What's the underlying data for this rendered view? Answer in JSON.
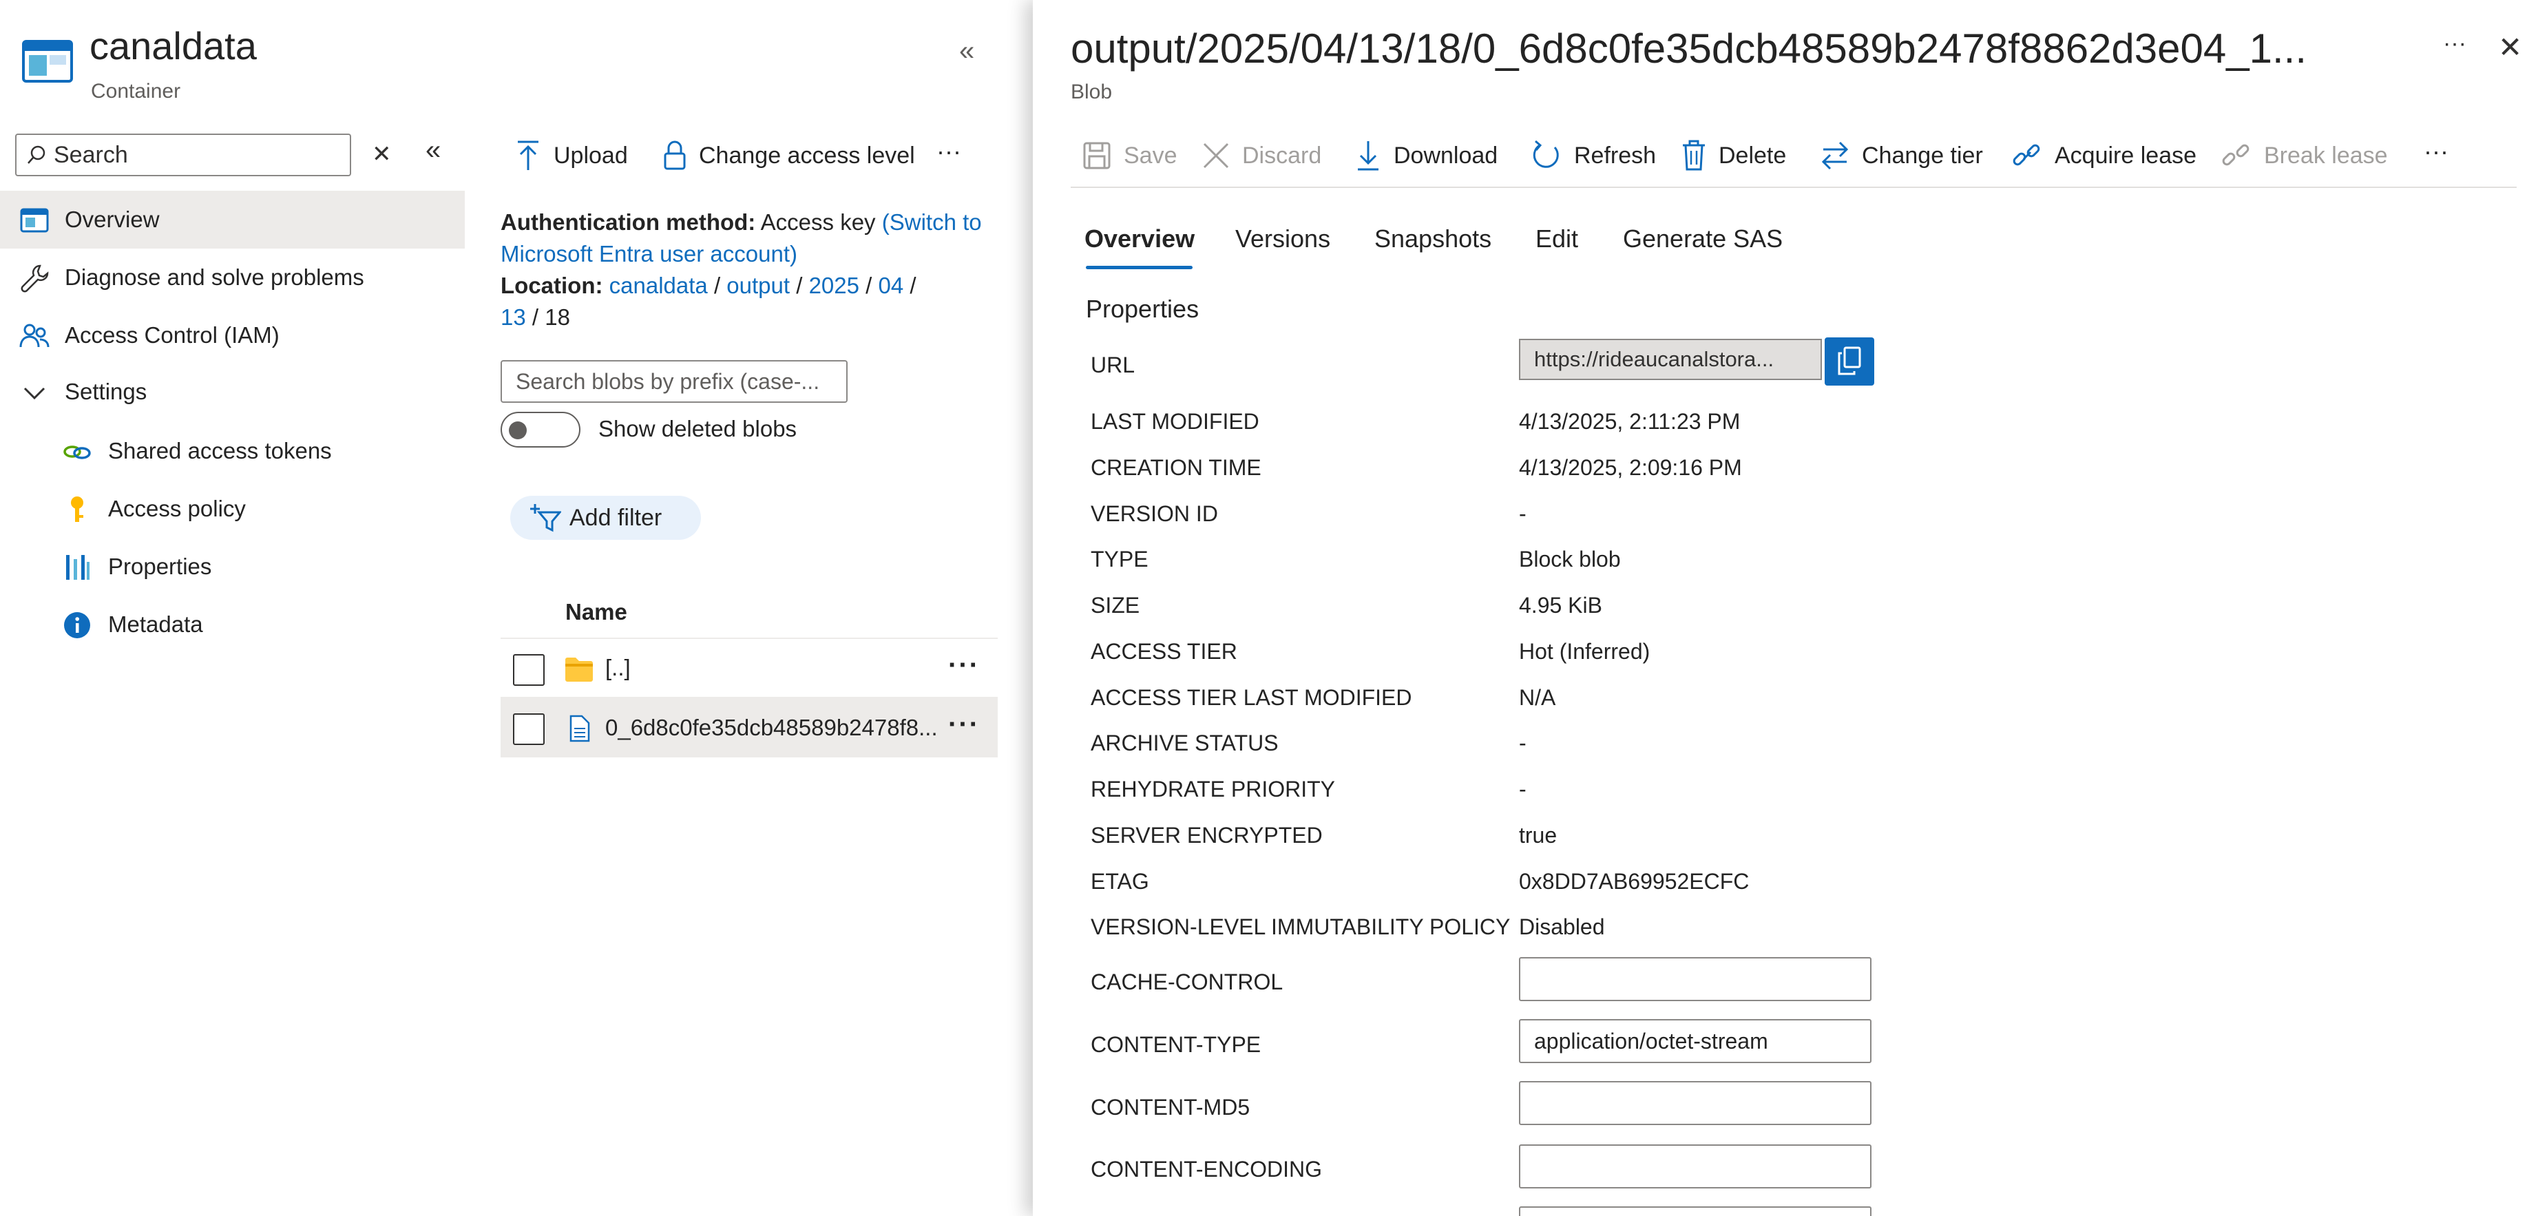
{
  "container": {
    "title": "canaldata",
    "subtitle": "Container",
    "search_placeholder": "Search"
  },
  "nav": {
    "overview": "Overview",
    "diagnose": "Diagnose and solve problems",
    "iam": "Access Control (IAM)",
    "settings": "Settings",
    "shared_access_tokens": "Shared access tokens",
    "access_policy": "Access policy",
    "properties": "Properties",
    "metadata": "Metadata"
  },
  "list_toolbar": {
    "upload": "Upload",
    "change_access_level": "Change access level",
    "more": "···"
  },
  "info": {
    "auth_label": "Authentication method:",
    "auth_value": "Access key",
    "auth_switch_link": "(Switch to Microsoft Entra user account)",
    "auth_switch_part1": "(Switch to",
    "auth_switch_part2": "Microsoft Entra user account)",
    "location_label": "Location:",
    "location_path": [
      "canaldata",
      "output",
      "2025",
      "04",
      "13",
      "18"
    ],
    "separator": "/"
  },
  "blob_list": {
    "search_placeholder": "Search blobs by prefix (case-...",
    "show_deleted_label": "Show deleted blobs",
    "show_deleted_on": false,
    "add_filter": "Add filter",
    "column_name": "Name",
    "rows": [
      {
        "name": "[..]",
        "type": "folder"
      },
      {
        "name": "0_6d8c0fe35dcb48589b2478f8...",
        "type": "file"
      }
    ],
    "row_more": "···"
  },
  "blob": {
    "title": "output/2025/04/13/18/0_6d8c0fe35dcb48589b2478f8862d3e04_1...",
    "subtitle": "Blob",
    "toolbar": {
      "save": "Save",
      "discard": "Discard",
      "download": "Download",
      "refresh": "Refresh",
      "delete": "Delete",
      "change_tier": "Change tier",
      "acquire_lease": "Acquire lease",
      "break_lease": "Break lease",
      "more": "···"
    },
    "header_more": "···",
    "tabs": [
      "Overview",
      "Versions",
      "Snapshots",
      "Edit",
      "Generate SAS"
    ],
    "active_tab": "Overview",
    "section_title": "Properties",
    "properties": {
      "url_label": "URL",
      "url_value": "https://rideaucanalstora...",
      "last_modified_label": "LAST MODIFIED",
      "last_modified_value": "4/13/2025, 2:11:23 PM",
      "creation_time_label": "CREATION TIME",
      "creation_time_value": "4/13/2025, 2:09:16 PM",
      "version_id_label": "VERSION ID",
      "version_id_value": "-",
      "type_label": "TYPE",
      "type_value": "Block blob",
      "size_label": "SIZE",
      "size_value": "4.95 KiB",
      "access_tier_label": "ACCESS TIER",
      "access_tier_value": "Hot (Inferred)",
      "access_tier_last_modified_label": "ACCESS TIER LAST MODIFIED",
      "access_tier_last_modified_value": "N/A",
      "archive_status_label": "ARCHIVE STATUS",
      "archive_status_value": "-",
      "rehydrate_priority_label": "REHYDRATE PRIORITY",
      "rehydrate_priority_value": "-",
      "server_encrypted_label": "SERVER ENCRYPTED",
      "server_encrypted_value": "true",
      "etag_label": "ETAG",
      "etag_value": "0x8DD7AB69952ECFC",
      "immutability_label": "VERSION-LEVEL IMMUTABILITY POLICY",
      "immutability_value": "Disabled",
      "cache_control_label": "CACHE-CONTROL",
      "cache_control_value": "",
      "content_type_label": "CONTENT-TYPE",
      "content_type_value": "application/octet-stream",
      "content_md5_label": "CONTENT-MD5",
      "content_md5_value": "",
      "content_encoding_label": "CONTENT-ENCODING",
      "content_encoding_value": ""
    }
  },
  "colors": {
    "accent": "#0f6cbd",
    "selected_bg": "#edebe9",
    "folder": "#ffc83d",
    "filter_pill": "#e8f1fb"
  },
  "icons": {
    "container": "container-icon",
    "overview": "overview-icon",
    "diagnose": "wrench-icon",
    "iam": "people-icon",
    "sas": "link-icon",
    "access_policy": "key-icon",
    "properties": "properties-icon",
    "metadata": "info-icon",
    "folder": "folder-icon",
    "file": "document-icon"
  }
}
